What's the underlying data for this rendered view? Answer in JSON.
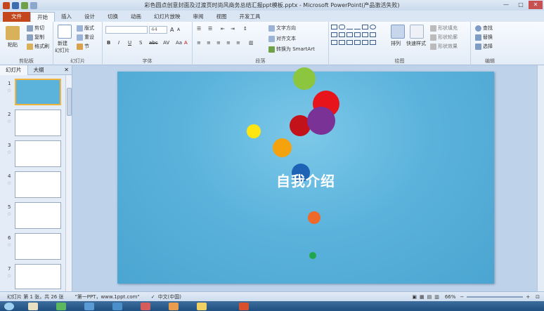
{
  "window": {
    "title": "彩色圆点创意封面及过渡页时尚风商务总结汇报ppt模板.pptx - Microsoft PowerPoint(产品激活失败)",
    "min": "—",
    "max": "□",
    "close": "✕"
  },
  "tabs": [
    "文件",
    "开始",
    "插入",
    "设计",
    "切换",
    "动画",
    "幻灯片放映",
    "审阅",
    "视图",
    "开发工具"
  ],
  "ribbon": {
    "clipboard": {
      "label": "剪贴板",
      "paste": "粘贴",
      "cut": "剪切",
      "copy": "复制",
      "format_painter": "格式刷"
    },
    "slides": {
      "label": "幻灯片",
      "new_slide": "新建",
      "new_slide2": "幻灯片",
      "layout": "版式",
      "reset": "重设",
      "section": "节"
    },
    "font": {
      "label": "字体",
      "size": "44"
    },
    "paragraph": {
      "label": "段落",
      "text_direction": "文字方向",
      "align_text": "对齐文本",
      "smartart": "转换为 SmartArt"
    },
    "drawing": {
      "label": "绘图",
      "arrange": "排列",
      "quick_styles": "快速样式",
      "fill": "形状填充",
      "outline": "形状轮廓",
      "effects": "形状效果"
    },
    "editing": {
      "label": "编辑",
      "find": "查找",
      "replace": "替换",
      "select": "选择"
    }
  },
  "left_pane": {
    "tab_slides": "幻灯片",
    "tab_outline": "大纲",
    "close": "✕",
    "slide_numbers": [
      "1",
      "2",
      "3",
      "4",
      "5",
      "6",
      "7"
    ]
  },
  "slide": {
    "title": "自我介绍"
  },
  "status": {
    "slide_info": "幻灯片 第 1 张，共 26 张",
    "theme": "\"第一PPT，www.1ppt.com\"",
    "language": "中文(中国)",
    "zoom": "66%"
  },
  "colors": {
    "file_tab": "#c4461d",
    "slide_bg": "#5bb3dc"
  }
}
